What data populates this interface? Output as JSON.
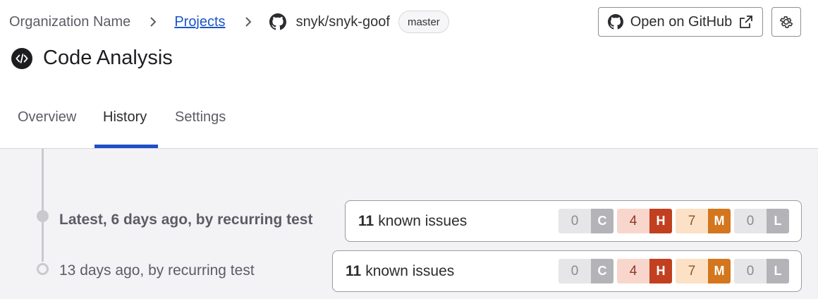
{
  "breadcrumb": {
    "org": "Organization Name",
    "projects": "Projects",
    "repo": "snyk/snyk-goof",
    "branch": "master"
  },
  "page": {
    "title": "Code Analysis"
  },
  "actions": {
    "open_github": "Open on GitHub"
  },
  "tabs": [
    {
      "label": "Overview",
      "active": false
    },
    {
      "label": "History",
      "active": true
    },
    {
      "label": "Settings",
      "active": false
    }
  ],
  "history": [
    {
      "label": "Latest, 6 days ago, by recurring test",
      "issues_count": "11",
      "issues_text": "known issues",
      "severity": [
        {
          "count": "0",
          "letter": "C"
        },
        {
          "count": "4",
          "letter": "H"
        },
        {
          "count": "7",
          "letter": "M"
        },
        {
          "count": "0",
          "letter": "L"
        }
      ]
    },
    {
      "label": "13 days ago, by recurring test",
      "issues_count": "11",
      "issues_text": "known issues",
      "severity": [
        {
          "count": "0",
          "letter": "C"
        },
        {
          "count": "4",
          "letter": "H"
        },
        {
          "count": "7",
          "letter": "M"
        },
        {
          "count": "0",
          "letter": "L"
        }
      ]
    }
  ],
  "colors": {
    "link": "#1a56c9",
    "tab_active": "#1f4fc5",
    "critical_zero_bg": "#e6e6e9",
    "critical_letter_bg": "#b3b3b8",
    "high_count_bg": "#f9d6cc",
    "high_letter_bg": "#c2401f",
    "medium_count_bg": "#fce1c6",
    "medium_letter_bg": "#d4761d",
    "low_zero_bg": "#e6e6e9",
    "low_letter_bg": "#b3b3b8"
  },
  "icons": [
    "chevron-right-icon",
    "github-icon",
    "code-icon",
    "external-link-icon",
    "gear-icon"
  ]
}
